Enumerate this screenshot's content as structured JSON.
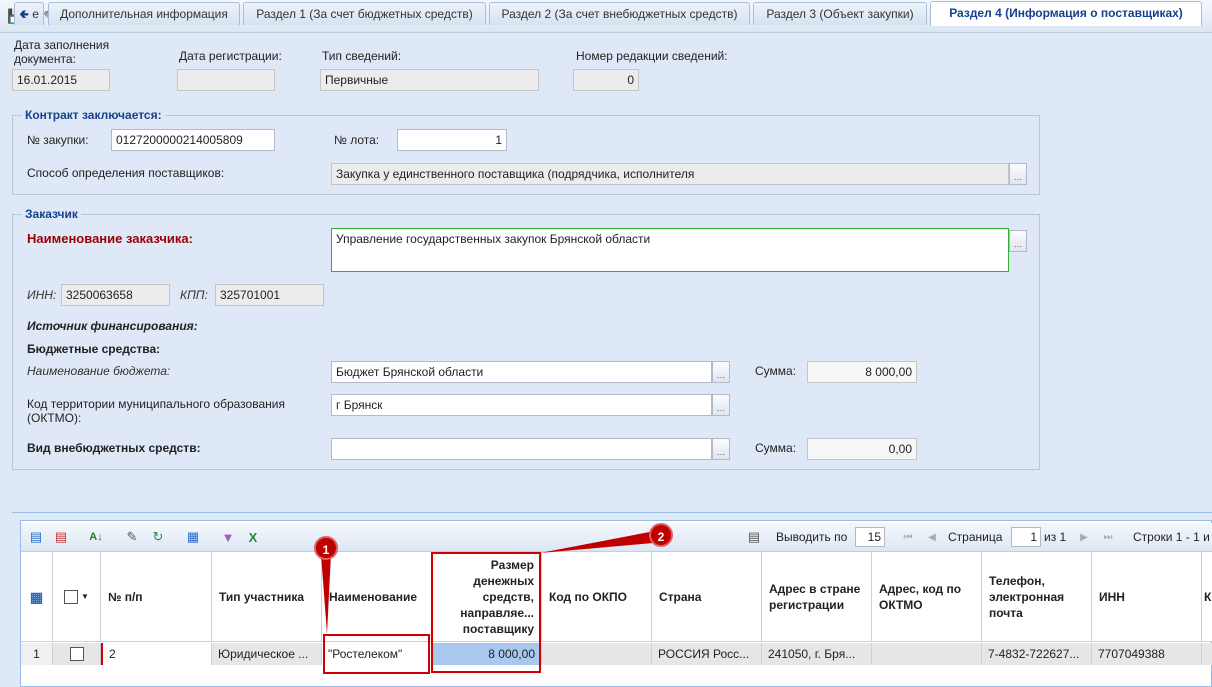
{
  "header": {
    "fill_date_label": "Дата заполнения документа:",
    "fill_date_value": "16.01.2015",
    "reg_date_label": "Дата регистрации:",
    "reg_date_value": "",
    "info_type_label": "Тип сведений:",
    "info_type_value": "Первичные",
    "revision_label": "Номер редакции сведений:",
    "revision_value": "0"
  },
  "contract": {
    "legend": "Контракт заключается:",
    "purchase_no_label": "№ закупки:",
    "purchase_no_value": "0127200000214005809",
    "lot_no_label": "№ лота:",
    "lot_no_value": "1",
    "method_label": "Способ определения поставщиков:",
    "method_value": "Закупка у единственного поставщика (подрядчика, исполнителя"
  },
  "customer": {
    "legend": "Заказчик",
    "name_label": "Наименование заказчика:",
    "name_value": "Управление государственных закупок Брянской области",
    "inn_label": "ИНН:",
    "inn_value": "3250063658",
    "kpp_label": "КПП:",
    "kpp_value": "325701001",
    "funding_label": "Источник финансирования:",
    "budget_label": "Бюджетные средства:",
    "budget_name_label": "Наименование бюджета:",
    "budget_name_value": "Бюджет Брянской области",
    "sum_label": "Сумма:",
    "budget_sum_value": "8 000,00",
    "oktmo_label": "Код территории муниципального образования (ОКТМО):",
    "oktmo_value": "г Брянск",
    "offbudget_label": "Вид внебюджетных средств:",
    "offbudget_value": "",
    "offbudget_sum_value": "0,00"
  },
  "tabs": [
    {
      "label": "е"
    },
    {
      "label": "Дополнительная информация"
    },
    {
      "label": "Раздел 1 (За счет бюджетных средств)"
    },
    {
      "label": "Раздел 2 (За счет внебюджетных средств)"
    },
    {
      "label": "Раздел 3 (Объект закупки)"
    },
    {
      "label": "Раздел 4 (Информация о поставщиках)"
    }
  ],
  "grid_toolbar": {
    "page_size_label": "Выводить по",
    "page_size_value": "15",
    "page_label": "Страница",
    "page_value": "1",
    "page_of": "из 1",
    "rows_label": "Строки 1 - 1 и"
  },
  "columns": [
    "№ п/п",
    "Тип участника",
    "Наименование",
    "Размер денежных средств, направляе... поставщику",
    "Код по ОКПО",
    "Страна",
    "Адрес в стране регистрации",
    "Адрес, код по ОКТМО",
    "Телефон, электронная почта",
    "ИНН",
    "К"
  ],
  "rows": [
    {
      "row_no": "1",
      "num": "2",
      "type": "Юридическое ...",
      "name": "\"Ростелеком\"",
      "amount": "8 000,00",
      "okpo": "",
      "country": "РОССИЯ Росс...",
      "address": "241050, г. Бря...",
      "oktmo_addr": "",
      "phone": "7-4832-722627...",
      "inn": "7707049388"
    }
  ],
  "callouts": [
    "1",
    "2"
  ],
  "colors": {
    "accent": "#15428b",
    "callout": "#c00000",
    "required": "#990000"
  }
}
